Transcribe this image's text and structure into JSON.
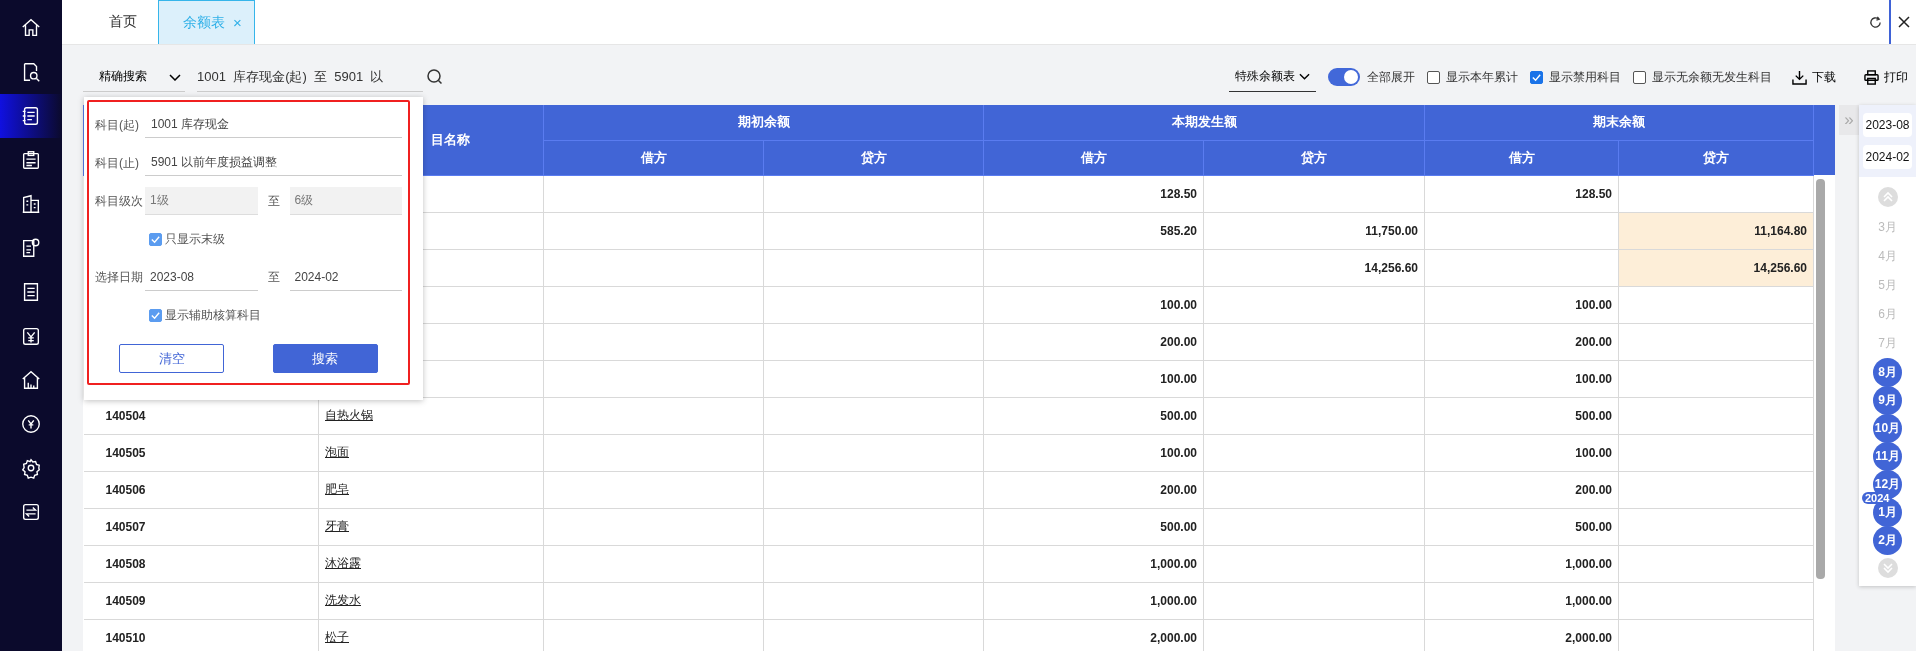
{
  "sidebar": {
    "items": [
      {
        "selected": false
      },
      {
        "selected": false
      },
      {
        "selected": true
      },
      {
        "selected": false
      },
      {
        "selected": false
      },
      {
        "selected": false
      },
      {
        "selected": false
      },
      {
        "selected": false
      },
      {
        "selected": false
      },
      {
        "selected": false
      },
      {
        "selected": false
      },
      {
        "selected": false
      }
    ]
  },
  "tabs": [
    {
      "label": "首页",
      "selected": false
    },
    {
      "label": "余额表",
      "selected": true,
      "close": "×"
    }
  ],
  "toolbar": {
    "search_mode": "精确搜索",
    "search_value": "1001  库存现金(起)  至  5901  以",
    "report_type": "特殊余额表",
    "toggle": {
      "label": "全部展开",
      "on": true
    },
    "checkboxes": [
      {
        "label": "显示本年累计",
        "checked": false
      },
      {
        "label": "显示禁用科目",
        "checked": true
      },
      {
        "label": "显示无余额无发生科目",
        "checked": false
      }
    ],
    "actions": [
      {
        "kind": "download",
        "label": "下载"
      },
      {
        "kind": "print",
        "label": "打印"
      }
    ]
  },
  "popup": {
    "highlighted": true,
    "rows": [
      {
        "kind": "text",
        "label": "科目(起)",
        "value": "1001  库存现金"
      },
      {
        "kind": "text",
        "label": "科目(止)",
        "value": "5901  以前年度损益调整"
      },
      {
        "kind": "range",
        "label": "科目级次",
        "from": "1级",
        "separator": "至",
        "to": "6级",
        "disabled": true
      },
      {
        "kind": "check",
        "label": "只显示末级",
        "checked": true
      },
      {
        "kind": "range",
        "label": "选择日期",
        "from": "2023-08",
        "separator": "至",
        "to": "2024-02",
        "disabled": false
      },
      {
        "kind": "check",
        "label": "显示辅助核算科目",
        "checked": true
      }
    ],
    "buttons": [
      {
        "label": "清空",
        "primary": false
      },
      {
        "label": "搜索",
        "primary": true
      }
    ]
  },
  "table": {
    "name_header": "目名称",
    "groups": [
      {
        "title": "期初余额",
        "columns": [
          "借方",
          "贷方"
        ]
      },
      {
        "title": "本期发生额",
        "columns": [
          "借方",
          "贷方"
        ]
      },
      {
        "title": "期末余额",
        "columns": [
          "借方",
          "贷方"
        ]
      }
    ],
    "rows": [
      {
        "period_debit": "128.50",
        "closing_debit": "128.50",
        "flagged": false
      },
      {
        "period_debit": "585.20",
        "period_credit": "11,750.00",
        "closing_credit": "11,164.80",
        "flagged": true
      },
      {
        "period_credit": "14,256.60",
        "closing_credit": "14,256.60",
        "flagged": true
      },
      {
        "period_debit": "100.00",
        "closing_debit": "100.00",
        "flagged": false
      },
      {
        "period_debit": "200.00",
        "closing_debit": "200.00",
        "flagged": false
      },
      {
        "period_debit": "100.00",
        "closing_debit": "100.00",
        "flagged": false
      },
      {
        "code": "140504",
        "name": "自热火锅",
        "period_debit": "500.00",
        "closing_debit": "500.00",
        "flagged": false
      },
      {
        "code": "140505",
        "name": "泡面",
        "period_debit": "100.00",
        "closing_debit": "100.00",
        "flagged": false
      },
      {
        "code": "140506",
        "name": "肥皂",
        "period_debit": "200.00",
        "closing_debit": "200.00",
        "flagged": false
      },
      {
        "code": "140507",
        "name": "牙膏",
        "period_debit": "500.00",
        "closing_debit": "500.00",
        "flagged": false
      },
      {
        "code": "140508",
        "name": "沐浴露",
        "period_debit": "1,000.00",
        "closing_debit": "1,000.00",
        "flagged": false
      },
      {
        "code": "140509",
        "name": "洗发水",
        "period_debit": "1,000.00",
        "closing_debit": "1,000.00",
        "flagged": false
      },
      {
        "code": "140510",
        "name": "松子",
        "period_debit": "2,000.00",
        "closing_debit": "2,000.00",
        "flagged": false
      }
    ]
  },
  "period_panel": {
    "collapse": "»",
    "start": "2023-08",
    "end": "2024-02",
    "months": [
      {
        "label": "3月",
        "selected": false
      },
      {
        "label": "4月",
        "selected": false
      },
      {
        "label": "5月",
        "selected": false
      },
      {
        "label": "6月",
        "selected": false
      },
      {
        "label": "7月",
        "selected": false
      },
      {
        "label": "8月",
        "selected": true
      },
      {
        "label": "9月",
        "selected": true
      },
      {
        "label": "10月",
        "selected": true
      },
      {
        "label": "11月",
        "selected": true
      },
      {
        "label": "12月",
        "selected": true
      },
      {
        "label": "1月",
        "selected": true,
        "year_badge": "2024"
      },
      {
        "label": "2月",
        "selected": true
      }
    ]
  }
}
